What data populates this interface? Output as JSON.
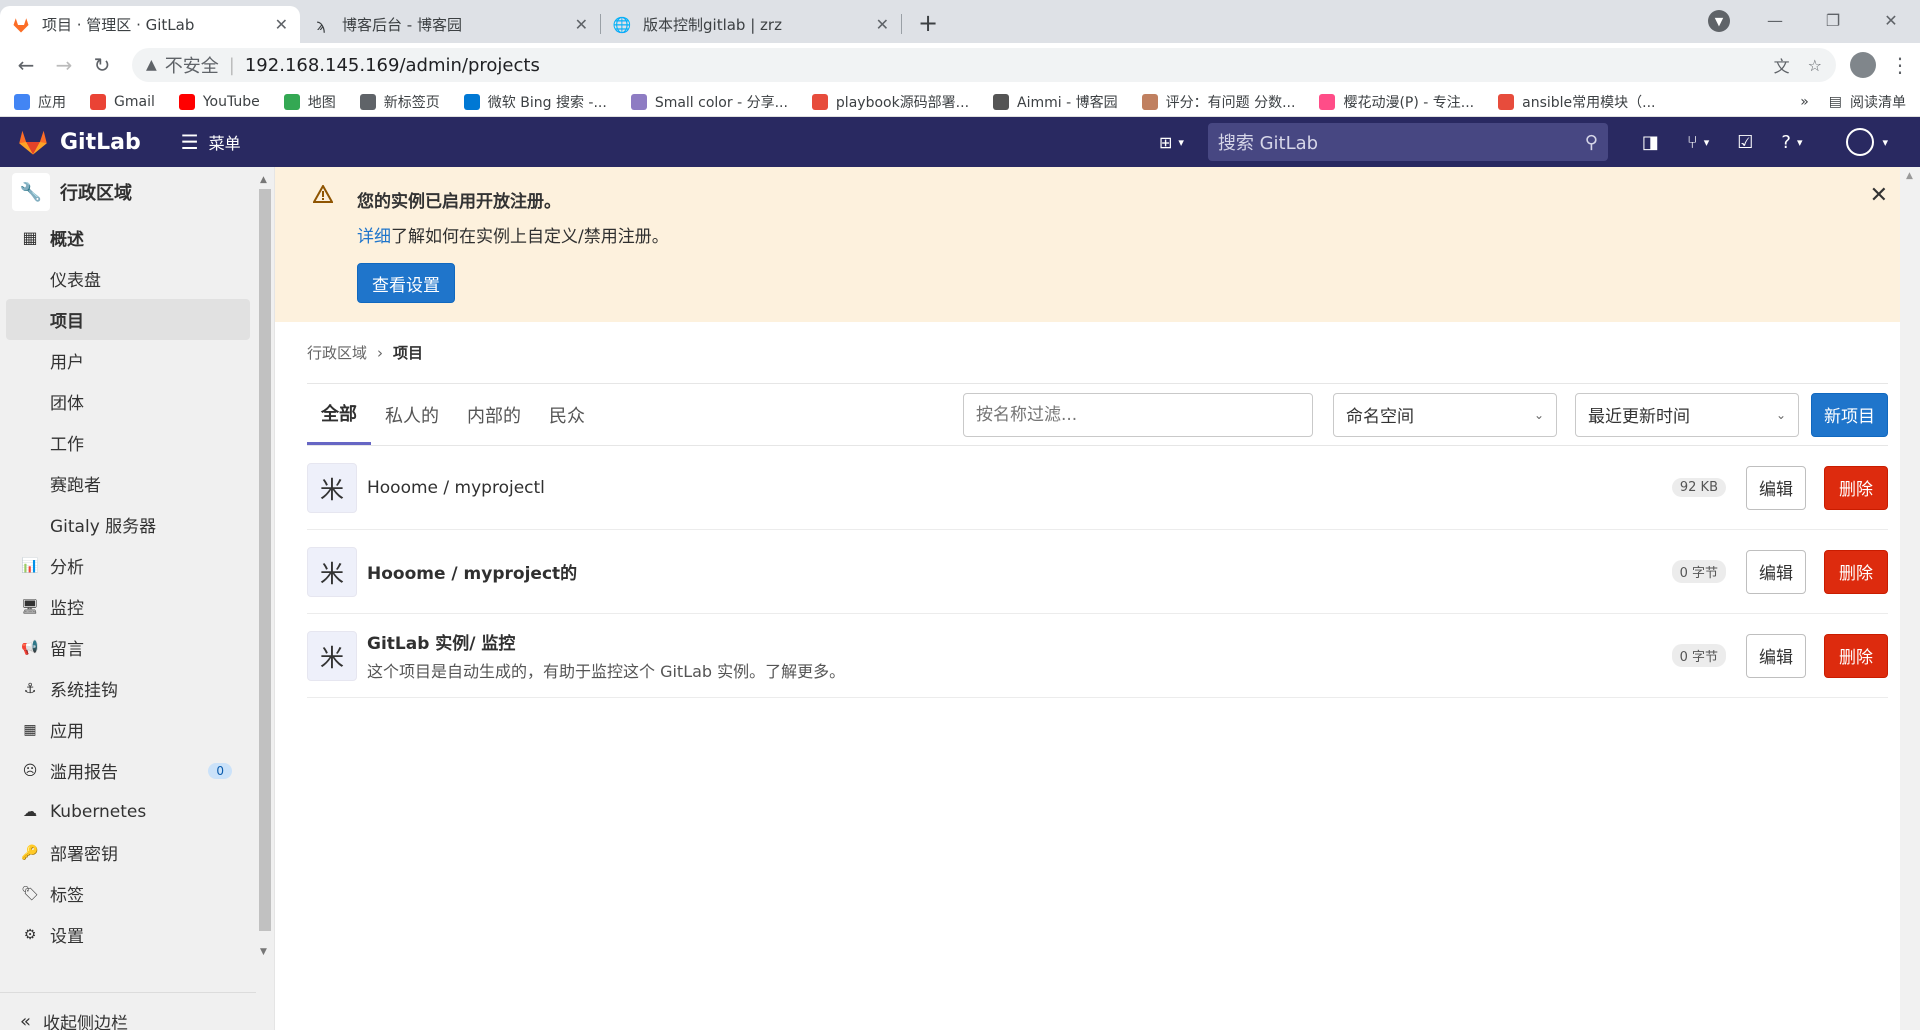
{
  "browser": {
    "tabs": [
      {
        "title": "项目 · 管理区 · GitLab",
        "active": true
      },
      {
        "title": "博客后台 - 博客园",
        "active": false
      },
      {
        "title": "版本控制gitlab | zrz",
        "active": false
      }
    ],
    "insecure_label": "不安全",
    "url": "192.168.145.169/admin/projects",
    "bookmarks": [
      {
        "label": "应用",
        "color": "#4285f4"
      },
      {
        "label": "Gmail",
        "color": "#ea4335"
      },
      {
        "label": "YouTube",
        "color": "#ff0000"
      },
      {
        "label": "地图",
        "color": "#34a853"
      },
      {
        "label": "新标签页",
        "color": "#5f6368"
      },
      {
        "label": "微软 Bing 搜索 -...",
        "color": "#0078d4"
      },
      {
        "label": "Small color - 分享...",
        "color": "#8e7cc3"
      },
      {
        "label": "playbook源码部署...",
        "color": "#e74c3c"
      },
      {
        "label": "Aimmi - 博客园",
        "color": "#555555"
      },
      {
        "label": "评分：有问题 分数...",
        "color": "#c08060"
      },
      {
        "label": "樱花动漫(P) - 专注...",
        "color": "#ff4d88"
      },
      {
        "label": "ansible常用模块（...",
        "color": "#e74c3c"
      }
    ],
    "more": "»",
    "reading_list": "阅读清单"
  },
  "gitlab": {
    "brand": "GitLab",
    "menu_label": "菜单",
    "search_placeholder": "搜索 GitLab",
    "colors": {
      "nav": "#292961",
      "primary": "#1f75cb",
      "danger": "#dd2b0e"
    }
  },
  "sidebar": {
    "header": "行政区域",
    "section_overview": "概述",
    "overview_items": [
      "仪表盘",
      "项目",
      "用户",
      "团体",
      "工作",
      "赛跑者",
      "Gitaly 服务器"
    ],
    "active_item": "项目",
    "items": [
      {
        "label": "分析",
        "icon": "chart-icon"
      },
      {
        "label": "监控",
        "icon": "monitor-icon"
      },
      {
        "label": "留言",
        "icon": "megaphone-icon"
      },
      {
        "label": "系统挂钩",
        "icon": "hook-icon"
      },
      {
        "label": "应用",
        "icon": "apps-icon"
      },
      {
        "label": "滥用报告",
        "icon": "abuse-icon",
        "badge": "0"
      },
      {
        "label": "Kubernetes",
        "icon": "kubernetes-icon"
      },
      {
        "label": "部署密钥",
        "icon": "key-icon"
      },
      {
        "label": "标签",
        "icon": "label-icon"
      },
      {
        "label": "设置",
        "icon": "settings-icon"
      }
    ],
    "collapse": "收起侧边栏"
  },
  "banner": {
    "title": "您的实例已启用开放注册。",
    "link": "详细",
    "text": "了解如何在实例上自定义/禁用注册。",
    "button": "查看设置"
  },
  "breadcrumb": {
    "root": "行政区域",
    "current": "项目"
  },
  "filter_tabs": [
    "全部",
    "私人的",
    "内部的",
    "民众"
  ],
  "filters": {
    "name_placeholder": "按名称过滤...",
    "namespace": "命名空间",
    "sort": "最近更新时间",
    "new_project": "新项目"
  },
  "projects": [
    {
      "name": "Hooome / myprojectl",
      "desc": "",
      "size": "92 KB",
      "bold": false
    },
    {
      "name": "Hooome / myproject的",
      "desc": "",
      "size": "0 字节",
      "bold": true
    },
    {
      "name": "GitLab 实例/ 监控",
      "desc": "这个项目是自动生成的，有助于监控这个 GitLab 实例。了解更多。",
      "size": "0 字节",
      "bold": true
    }
  ],
  "row_actions": {
    "edit": "编辑",
    "delete": "删除"
  }
}
